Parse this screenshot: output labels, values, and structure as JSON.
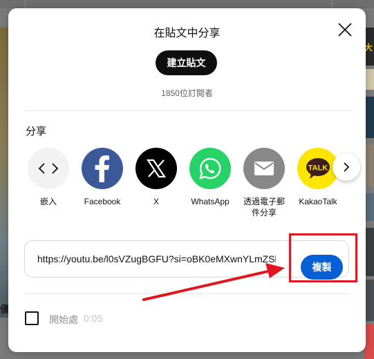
{
  "dialog": {
    "title": "在貼文中分享",
    "create_post_label": "建立貼文",
    "subscribers": "1850位訂閱者",
    "share_heading": "分享",
    "share_options": [
      {
        "label": "嵌入",
        "icon": "embed-code-icon",
        "bg": "#f2f2f2"
      },
      {
        "label": "Facebook",
        "icon": "facebook-icon",
        "bg": "#3b5998"
      },
      {
        "label": "X",
        "icon": "x-icon",
        "bg": "#000000"
      },
      {
        "label": "WhatsApp",
        "icon": "whatsapp-icon",
        "bg": "#25d366"
      },
      {
        "label": "透過電子郵件分享",
        "line1": "透過電子郵",
        "line2": "件分享",
        "icon": "email-icon",
        "bg": "#888888"
      },
      {
        "label": "KakaoTalk",
        "icon": "kakaotalk-icon",
        "bg": "#fee500"
      }
    ],
    "share_url": "https://youtu.be/l0sVZugBGFU?si=oBK0eMXwnYLmZSl",
    "copy_label": "複製",
    "start_at_label": "開始處",
    "start_at_time": "0:05",
    "kakao_badge": "TALK"
  },
  "annotation": {
    "highlight_color": "#e0151f"
  },
  "colors": {
    "accent": "#065fd4",
    "annotation": "#e0151f"
  }
}
